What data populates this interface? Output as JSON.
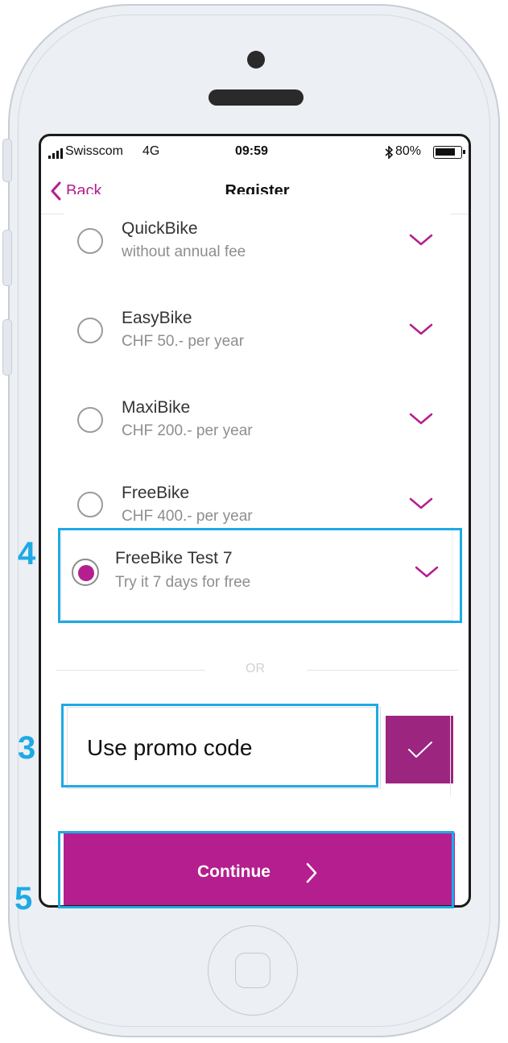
{
  "status_bar": {
    "carrier": "Swisscom",
    "network": "4G",
    "time": "09:59",
    "battery": "80%"
  },
  "nav": {
    "back_label": "Back",
    "title": "Register"
  },
  "plans": [
    {
      "name": "QuickBike",
      "description": "without annual fee",
      "selected": false
    },
    {
      "name": "EasyBike",
      "description": "CHF 50.- per year",
      "selected": false
    },
    {
      "name": "MaxiBike",
      "description": "CHF 200.- per year",
      "selected": false
    },
    {
      "name": "FreeBike",
      "description": "CHF 400.- per year",
      "selected": false
    },
    {
      "name": "FreeBike Test 7",
      "description": "Try it 7 days for free",
      "selected": true
    }
  ],
  "divider_label": "OR",
  "promo": {
    "placeholder": "Use promo code"
  },
  "continue_label": "Continue",
  "annotations": {
    "plan_step": "4",
    "promo_step": "3",
    "continue_step": "5"
  },
  "colors": {
    "accent": "#b51e8e",
    "promo_submit": "#9c2580",
    "annotation": "#1eaae4"
  }
}
